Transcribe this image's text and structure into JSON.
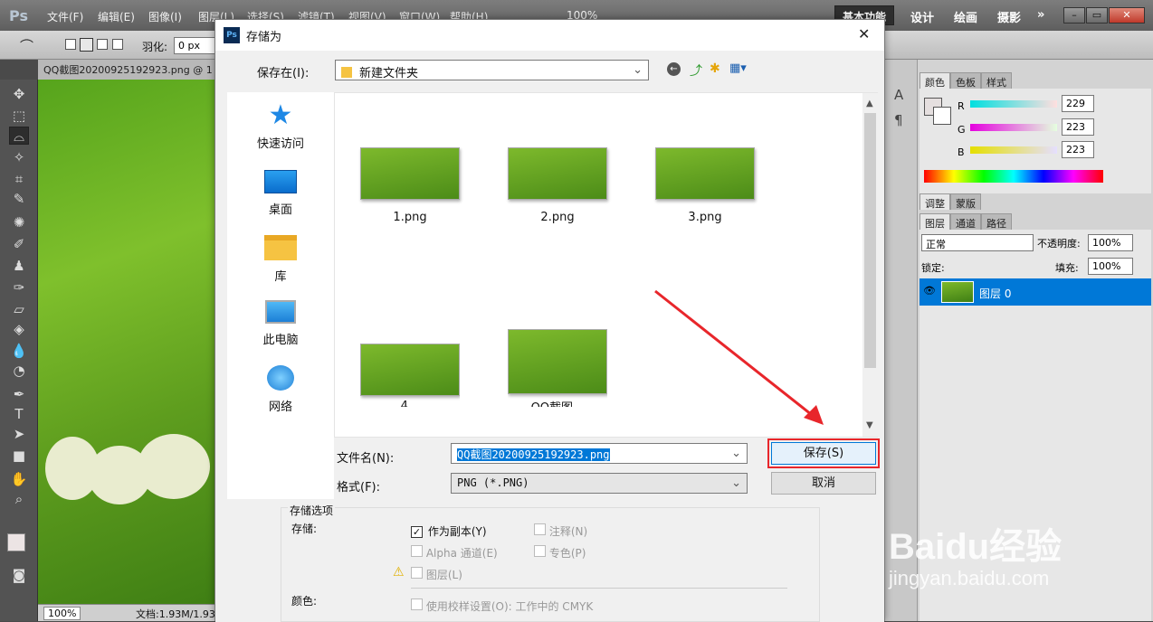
{
  "ps": {
    "logo": "Ps",
    "menu": [
      "文件(F)",
      "编辑(E)",
      "图像(I)",
      "图层(L)",
      "选择(S)",
      "滤镜(T)",
      "视图(V)",
      "窗口(W)",
      "帮助(H)"
    ],
    "zoom_menu": "100%",
    "workspaces": {
      "basic": "基本功能",
      "design": "设计",
      "paint": "绘画",
      "photo": "摄影",
      "more": "»"
    },
    "feather_label": "羽化:",
    "feather_value": "0 px",
    "doc_tab": "QQ截图20200925192923.png @ 1",
    "status_zoom": "100%",
    "status_doc": "文档:1.93M/1.93"
  },
  "panels": {
    "color_tabs": [
      "颜色",
      "色板",
      "样式"
    ],
    "r_label": "R",
    "g_label": "G",
    "b_label": "B",
    "r_value": "229",
    "g_value": "223",
    "b_value": "223",
    "adjust_tabs": [
      "调整",
      "蒙版"
    ],
    "layer_tabs": [
      "图层",
      "通道",
      "路径"
    ],
    "blend_mode": "正常",
    "opacity_label": "不透明度:",
    "opacity_value": "100%",
    "lock_label": "锁定:",
    "fill_label": "填充:",
    "fill_value": "100%",
    "layer_name": "图层 0"
  },
  "dialog": {
    "title": "存储为",
    "save_in_label": "保存在(I):",
    "save_in_value": "新建文件夹",
    "places": [
      "快速访问",
      "桌面",
      "库",
      "此电脑",
      "网络"
    ],
    "files": [
      "1.png",
      "2.png",
      "3.png",
      "4...",
      "QQ截图..."
    ],
    "filename_label": "文件名(N):",
    "filename_value": "QQ截图20200925192923.png",
    "format_label": "格式(F):",
    "format_value": "PNG (*.PNG)",
    "save_button": "保存(S)",
    "cancel_button": "取消",
    "options_title": "存储选项",
    "store_label": "存储:",
    "opt_copy": "作为副本(Y)",
    "opt_notes": "注释(N)",
    "opt_alpha": "Alpha 通道(E)",
    "opt_spot": "专色(P)",
    "opt_layers": "图层(L)",
    "color_label": "颜色:",
    "opt_proof": "使用校样设置(O): 工作中的 CMYK"
  },
  "watermark": {
    "brand": "Baidu经验",
    "url": "jingyan.baidu.com"
  },
  "colors": {
    "highlight": "#0078d7",
    "annotation": "#e8262b",
    "canvas_green": "#6aaa24"
  }
}
